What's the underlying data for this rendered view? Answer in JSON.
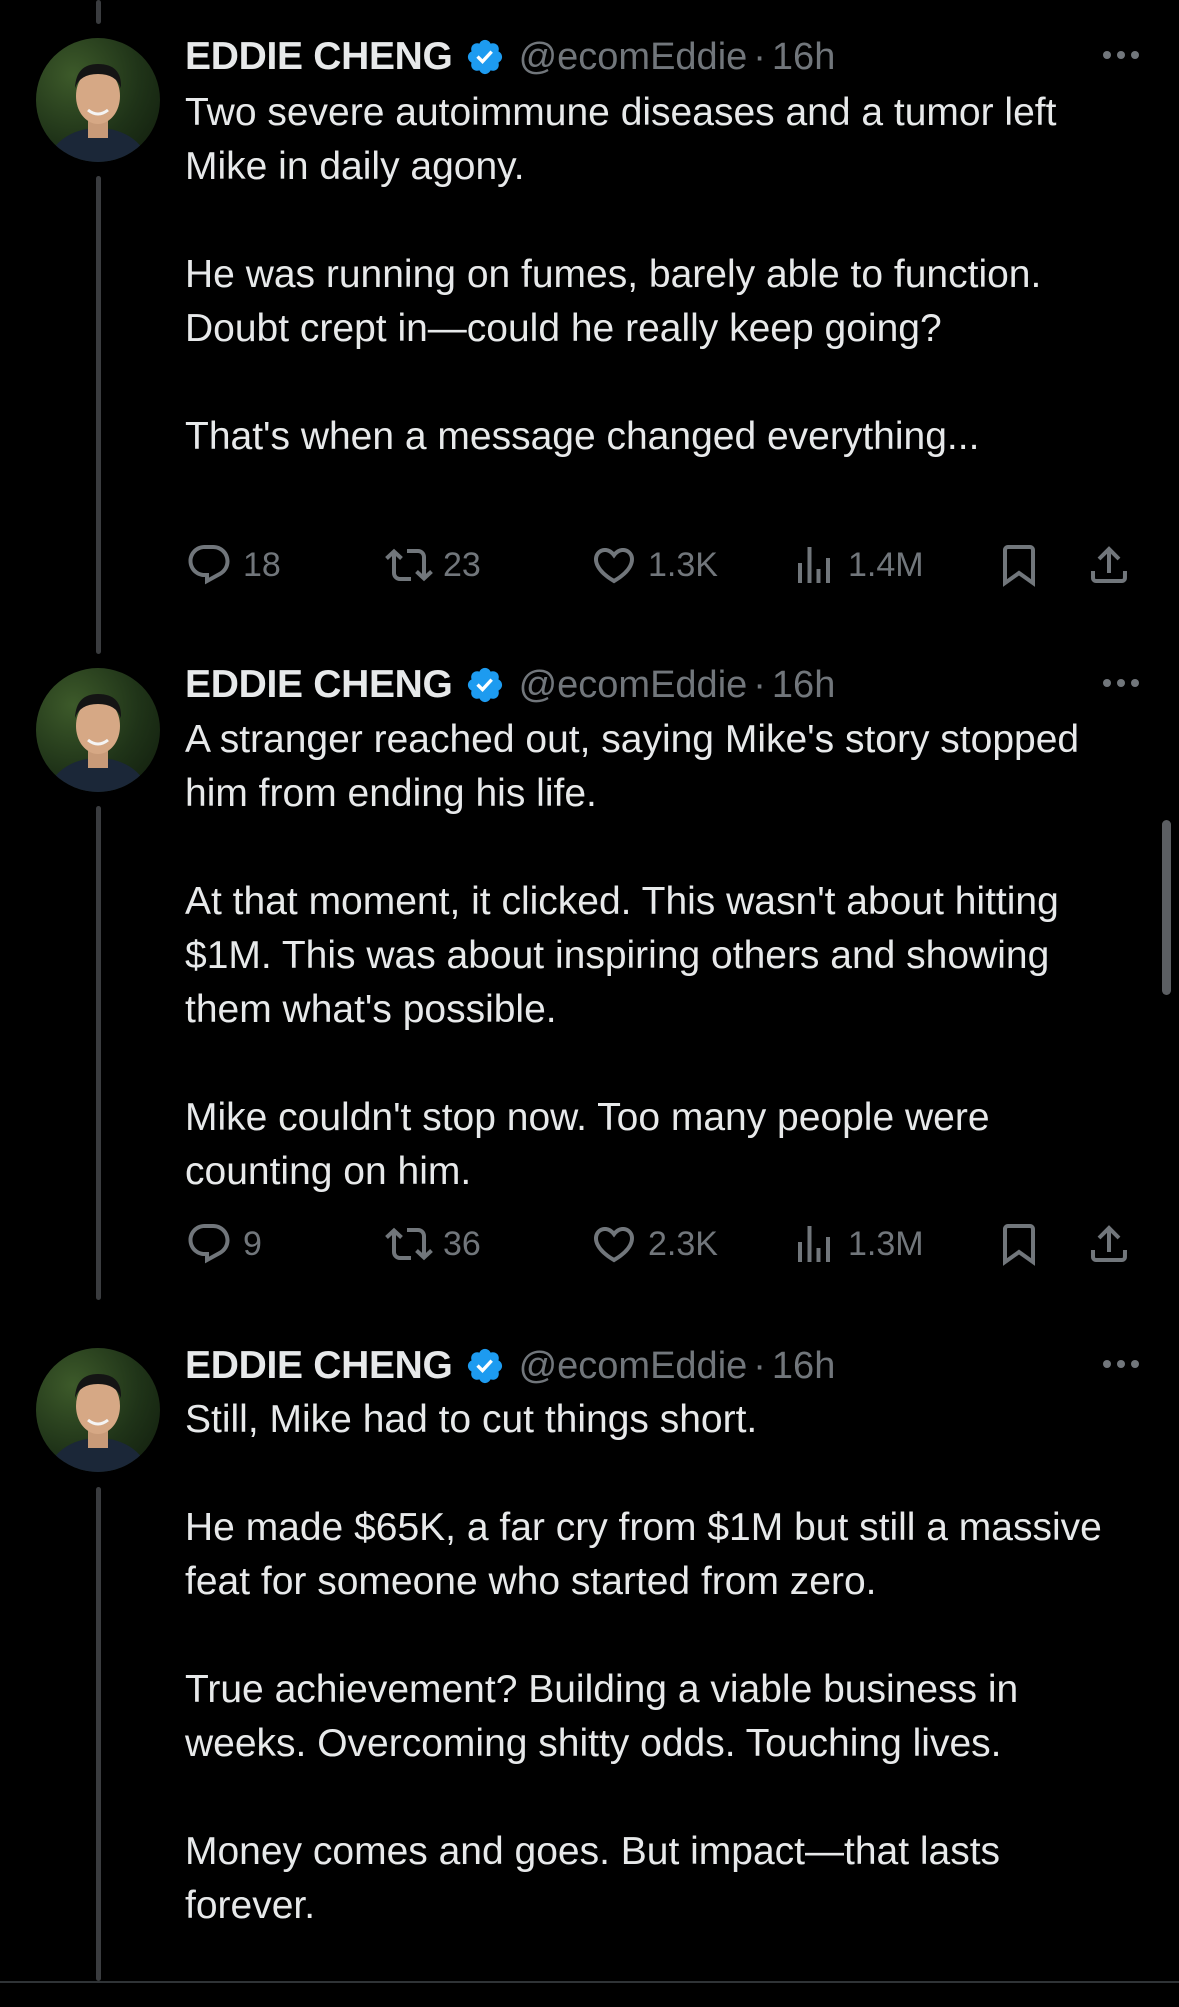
{
  "author": {
    "name": "EDDIE CHENG",
    "handle": "@ecomEddie",
    "separator": "·"
  },
  "colors": {
    "background": "#000000",
    "text": "#e7e9ea",
    "muted": "#71767b",
    "verified": "#1d9bf0",
    "thread_line": "#3a3c3f"
  },
  "icons": {
    "reply": "reply-icon",
    "retweet": "retweet-icon",
    "like": "heart-icon",
    "views": "views-icon",
    "bookmark": "bookmark-icon",
    "share": "share-icon",
    "more": "more-icon",
    "verified": "verified-badge-icon"
  },
  "tweets": [
    {
      "time": "16h",
      "paragraphs": [
        "Two severe autoimmune diseases and a tumor left Mike in daily agony.",
        "He was running on fumes, barely able to function. Doubt crept in—could he really keep going?",
        "That's when a message changed everything..."
      ],
      "stats": {
        "replies": "18",
        "retweets": "23",
        "likes": "1.3K",
        "views": "1.4M"
      }
    },
    {
      "time": "16h",
      "paragraphs": [
        "A stranger reached out, saying Mike's story stopped him from ending his life.",
        "At that moment, it clicked. This wasn't about hitting $1M. This was about inspiring others and showing them what's possible.",
        "Mike couldn't stop now. Too many people were counting on him."
      ],
      "stats": {
        "replies": "9",
        "retweets": "36",
        "likes": "2.3K",
        "views": "1.3M"
      }
    },
    {
      "time": "16h",
      "paragraphs": [
        "Still, Mike had to cut things short.",
        "He made $65K, a far cry from $1M but still a massive feat for someone who started from zero.",
        "True achievement? Building a viable business in weeks. Overcoming shitty odds. Touching lives.",
        "Money comes and goes. But impact—that lasts forever."
      ]
    }
  ]
}
